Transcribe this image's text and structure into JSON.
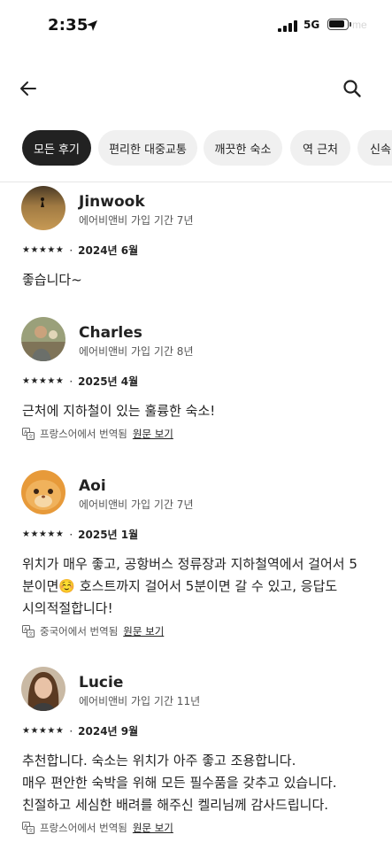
{
  "status_bar": {
    "time": "2:35",
    "network": "5G",
    "watermark": "me"
  },
  "chips": [
    {
      "label": "모든 후기",
      "active": true
    },
    {
      "label": "편리한 대중교통",
      "active": false
    },
    {
      "label": "깨끗한 숙소",
      "active": false
    },
    {
      "label": "역 근처",
      "active": false
    },
    {
      "label": "신속",
      "active": false
    }
  ],
  "reviews": [
    {
      "name": "Jinwook",
      "tenure": "에어비앤비 가입 기간 7년",
      "stars": "★★★★★",
      "sep": "·",
      "date": "2024년 6월",
      "lines": [
        "좋습니다~"
      ]
    },
    {
      "name": "Charles",
      "tenure": "에어비앤비 가입 기간 8년",
      "stars": "★★★★★",
      "sep": "·",
      "date": "2025년 4월",
      "lines": [
        "근처에 지하철이 있는 훌륭한 숙소!"
      ],
      "translated_from": "프랑스어에서 번역됨",
      "original_link": "원문 보기"
    },
    {
      "name": "Aoi",
      "tenure": "에어비앤비 가입 기간 7년",
      "stars": "★★★★★",
      "sep": "·",
      "date": "2025년 1월",
      "lines": [
        "위치가 매우 좋고, 공항버스 정류장과 지하철역에서 걸어서 5",
        "분이면☺️ 호스트까지 걸어서 5분이면 갈 수 있고, 응답도",
        "시의적절합니다!"
      ],
      "translated_from": "중국어에서 번역됨",
      "original_link": "원문 보기"
    },
    {
      "name": "Lucie",
      "tenure": "에어비앤비 가입 기간 11년",
      "stars": "★★★★★",
      "sep": "·",
      "date": "2024년 9월",
      "lines": [
        "추천합니다. 숙소는 위치가 아주 좋고 조용합니다.",
        "매우 편안한 숙박을 위해 모든 필수품을 갖추고 있습니다.",
        "친절하고 세심한 배려를 해주신 켈리님께 감사드립니다."
      ],
      "translated_from": "프랑스어에서 번역됨",
      "original_link": "원문 보기"
    }
  ]
}
